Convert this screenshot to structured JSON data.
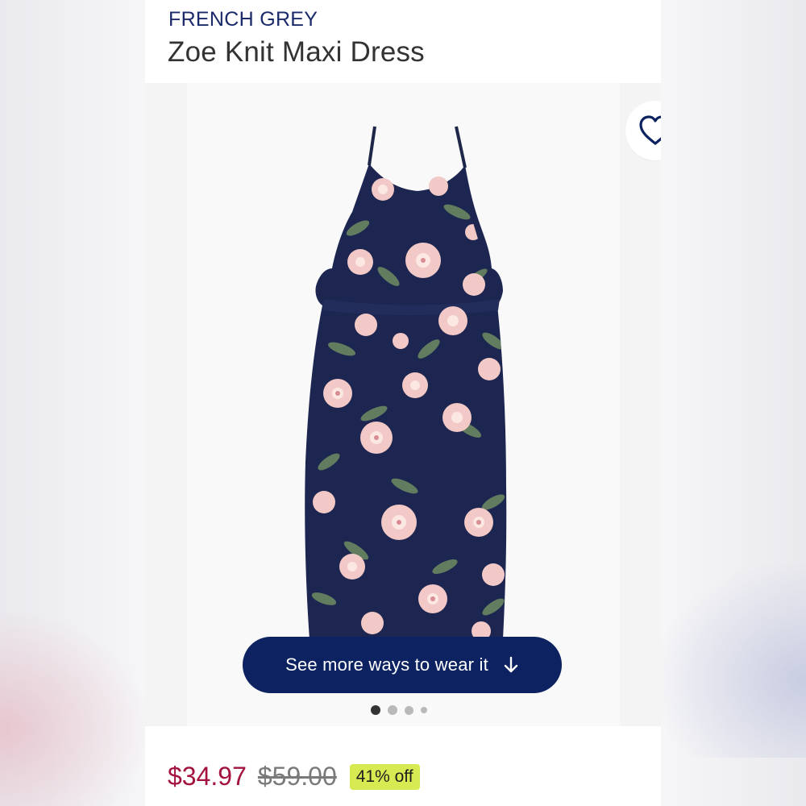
{
  "product": {
    "brand": "FRENCH GREY",
    "title": "Zoe Knit Maxi Dress"
  },
  "gallery": {
    "wear_button_label": "See more ways to wear it",
    "wear_button_icon": "arrow-down-icon",
    "favorite_icon": "heart-icon",
    "image_count": 4,
    "active_index": 0
  },
  "pricing": {
    "sale_price": "$34.97",
    "original_price": "$59.00",
    "discount_badge": "41% off"
  },
  "colors": {
    "brand_navy": "#1b2a6b",
    "button_navy": "#0d2361",
    "sale_red": "#a3133d",
    "badge_lime": "#d8ea52"
  }
}
